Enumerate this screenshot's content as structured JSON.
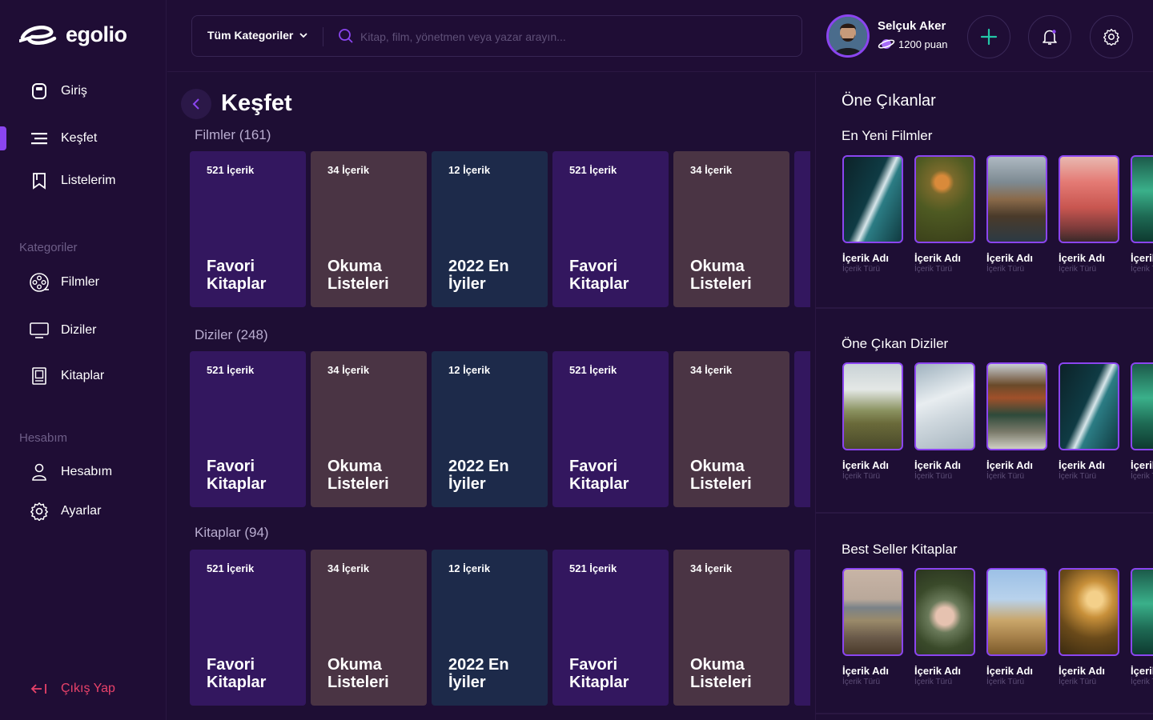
{
  "brand": {
    "name": "egolio"
  },
  "sidebar": {
    "items": [
      {
        "label": "Giriş",
        "icon": "home-icon"
      },
      {
        "label": "Keşfet",
        "icon": "explore-icon",
        "active": true
      },
      {
        "label": "Listelerim",
        "icon": "bookmark-icon"
      }
    ],
    "categories_label": "Kategoriler",
    "categories": [
      {
        "label": "Filmler",
        "icon": "film-reel-icon"
      },
      {
        "label": "Diziler",
        "icon": "tv-icon"
      },
      {
        "label": "Kitaplar",
        "icon": "book-icon"
      }
    ],
    "account_label": "Hesabım",
    "account": [
      {
        "label": "Hesabım",
        "icon": "user-icon"
      },
      {
        "label": "Ayarlar",
        "icon": "gear-icon"
      }
    ],
    "logout": "Çıkış Yap"
  },
  "topbar": {
    "category_select": "Tüm Kategoriler",
    "search_placeholder": "Kitap, film, yönetmen veya yazar arayın...",
    "user": {
      "name": "Selçuk Aker",
      "points": "1200 puan"
    }
  },
  "main": {
    "title": "Keşfet",
    "rows": [
      {
        "title": "Filmler (161)",
        "cards": [
          {
            "count": "521 İçerik",
            "title": "Favori Kitaplar"
          },
          {
            "count": "34 İçerik",
            "title": "Okuma Listeleri"
          },
          {
            "count": "12 İçerik",
            "title": "2022 En İyiler"
          },
          {
            "count": "521 İçerik",
            "title": "Favori Kitaplar"
          },
          {
            "count": "34 İçerik",
            "title": "Okuma Listeleri"
          }
        ]
      },
      {
        "title": "Diziler (248)",
        "cards": [
          {
            "count": "521 İçerik",
            "title": "Favori Kitaplar"
          },
          {
            "count": "34 İçerik",
            "title": "Okuma Listeleri"
          },
          {
            "count": "12 İçerik",
            "title": "2022 En İyiler"
          },
          {
            "count": "521 İçerik",
            "title": "Favori Kitaplar"
          },
          {
            "count": "34 İçerik",
            "title": "Okuma Listeleri"
          }
        ]
      },
      {
        "title": "Kitaplar (94)",
        "cards": [
          {
            "count": "521 İçerik",
            "title": "Favori Kitaplar"
          },
          {
            "count": "34 İçerik",
            "title": "Okuma Listeleri"
          },
          {
            "count": "12 İçerik",
            "title": "2022 En İyiler"
          },
          {
            "count": "521 İçerik",
            "title": "Favori Kitaplar"
          },
          {
            "count": "34 İçerik",
            "title": "Okuma Listeleri"
          }
        ]
      }
    ]
  },
  "right_panel": {
    "heading": "Öne Çıkanlar",
    "sections": [
      {
        "title": "En Yeni Filmler",
        "items": [
          {
            "name": "İçerik Adı",
            "type": "İçerik Türü"
          },
          {
            "name": "İçerik Adı",
            "type": "İçerik Türü"
          },
          {
            "name": "İçerik Adı",
            "type": "İçerik Türü"
          },
          {
            "name": "İçerik Adı",
            "type": "İçerik Türü"
          },
          {
            "name": "İçerik Adı",
            "type": "İçerik Türü"
          }
        ]
      },
      {
        "title": "Öne Çıkan Diziler",
        "items": [
          {
            "name": "İçerik Adı",
            "type": "İçerik Türü"
          },
          {
            "name": "İçerik Adı",
            "type": "İçerik Türü"
          },
          {
            "name": "İçerik Adı",
            "type": "İçerik Türü"
          },
          {
            "name": "İçerik Adı",
            "type": "İçerik Türü"
          },
          {
            "name": "İçerik Adı",
            "type": "İçerik Türü"
          }
        ]
      },
      {
        "title": "Best Seller Kitaplar",
        "items": [
          {
            "name": "İçerik Adı",
            "type": "İçerik Türü"
          },
          {
            "name": "İçerik Adı",
            "type": "İçerik Türü"
          },
          {
            "name": "İçerik Adı",
            "type": "İçerik Türü"
          },
          {
            "name": "İçerik Adı",
            "type": "İçerik Türü"
          },
          {
            "name": "İçerik Adı",
            "type": "İçerik Türü"
          }
        ]
      }
    ]
  },
  "colors": {
    "accent": "#8b45f0",
    "background": "#1e0e34",
    "logout": "#e8426a"
  }
}
